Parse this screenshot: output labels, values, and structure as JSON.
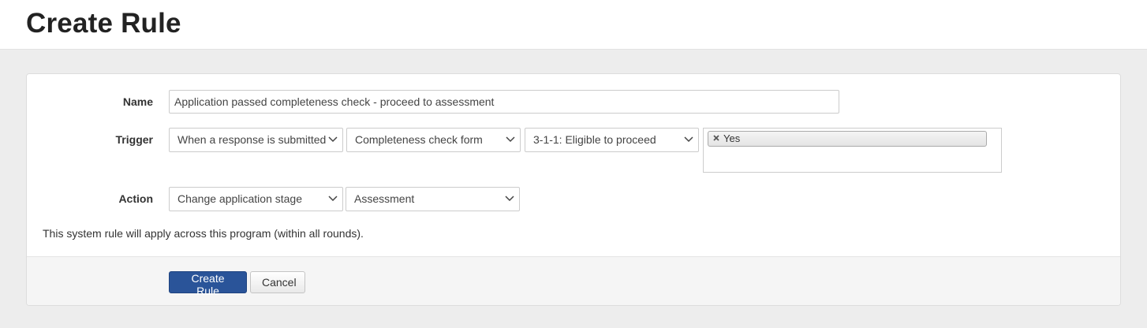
{
  "page": {
    "title": "Create Rule"
  },
  "form": {
    "name": {
      "label": "Name",
      "value": "Application passed completeness check - proceed to assessment"
    },
    "trigger": {
      "label": "Trigger",
      "event": "When a response is submitted",
      "form": "Completeness check form",
      "question": "3-1-1: Eligible to proceed",
      "selected_answers": [
        "Yes"
      ]
    },
    "action": {
      "label": "Action",
      "type": "Change application stage",
      "stage": "Assessment"
    },
    "note": "This system rule will apply across this program (within all rounds)."
  },
  "footer": {
    "submit_label": "Create Rule",
    "cancel_label": "Cancel"
  },
  "icons": {
    "select": "chevron-down-icon",
    "token_remove": "close-icon"
  },
  "colors": {
    "primary": "#2a5499",
    "background": "#ededed"
  }
}
